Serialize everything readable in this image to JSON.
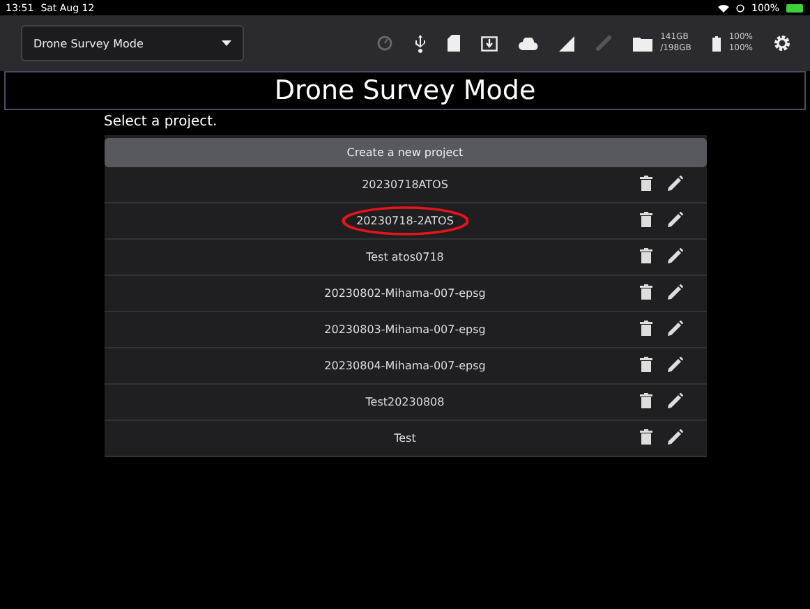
{
  "status_bar": {
    "time": "13:51",
    "date": "Sat Aug 12",
    "battery": "100%"
  },
  "toolbar": {
    "mode_select": {
      "value": "Drone Survey Mode"
    },
    "storage": {
      "used": "141GB",
      "total": "/198GB"
    },
    "battery": {
      "line_1": "100%",
      "line_2": "100%"
    }
  },
  "title": "Drone Survey Mode",
  "prompt": "Select a project.",
  "create_button": "Create a new project",
  "projects": [
    {
      "name": "20230718ATOS",
      "circled": false
    },
    {
      "name": "20230718-2ATOS",
      "circled": true
    },
    {
      "name": "Test atos0718",
      "circled": false
    },
    {
      "name": "20230802-Mihama-007-epsg",
      "circled": false
    },
    {
      "name": "20230803-Mihama-007-epsg",
      "circled": false
    },
    {
      "name": "20230804-Mihama-007-epsg",
      "circled": false
    },
    {
      "name": "Test20230808",
      "circled": false
    },
    {
      "name": "Test",
      "circled": false
    }
  ]
}
